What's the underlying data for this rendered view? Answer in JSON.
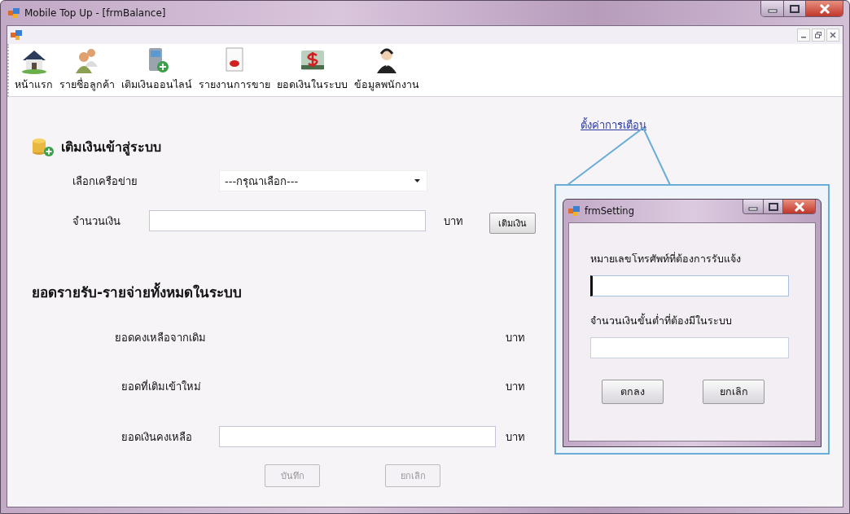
{
  "window": {
    "title": "Mobile Top Up - [frmBalance]"
  },
  "toolbar": [
    {
      "label": "หน้าแรก",
      "kind": "home"
    },
    {
      "label": "รายชื่อลูกค้า",
      "kind": "customers"
    },
    {
      "label": "เติมเงินออนไลน์",
      "kind": "topup"
    },
    {
      "label": "รายงานการขาย",
      "kind": "report"
    },
    {
      "label": "ยอดเงินในระบบ",
      "kind": "balance"
    },
    {
      "label": "ข้อมูลพนักงาน",
      "kind": "staff"
    }
  ],
  "topup_section": {
    "heading": "เติมเงินเข้าสู่ระบบ",
    "network": {
      "label": "เลือกเครือข่าย",
      "value": "---กรุณาเลือก---"
    },
    "amount": {
      "label": "จำนวนเงิน",
      "unit": "บาท",
      "button": "เติมเงิน"
    }
  },
  "summary_section": {
    "heading": "ยอดรายรับ-รายจ่ายทั้งหมดในระบบ",
    "rows": [
      {
        "label": "ยอดคงเหลือจากเดิม",
        "unit": "บาท",
        "kind": "text"
      },
      {
        "label": "ยอดที่เติมเข้าใหม่",
        "unit": "บาท",
        "kind": "text"
      },
      {
        "label": "ยอดเงินคงเหลือ",
        "unit": "บาท",
        "kind": "field"
      }
    ],
    "buttons": [
      {
        "label": "บันทึก",
        "disabled": true
      },
      {
        "label": "ยกเลิก",
        "disabled": true
      }
    ]
  },
  "settings_link": "ตั้งค่าการเตือน",
  "setting_window": {
    "title": "frmSetting",
    "fields": [
      {
        "label": "หมายเลขโทรศัพท์ที่ต้องการรับแจ้ง",
        "focused": true
      },
      {
        "label": "จำนวนเงินขั้นต่ำที่ต้องมีในระบบ",
        "focused": false
      }
    ],
    "buttons": [
      {
        "label": "ตกลง",
        "disabled": false
      },
      {
        "label": "ยกเลิก",
        "disabled": false
      }
    ]
  }
}
